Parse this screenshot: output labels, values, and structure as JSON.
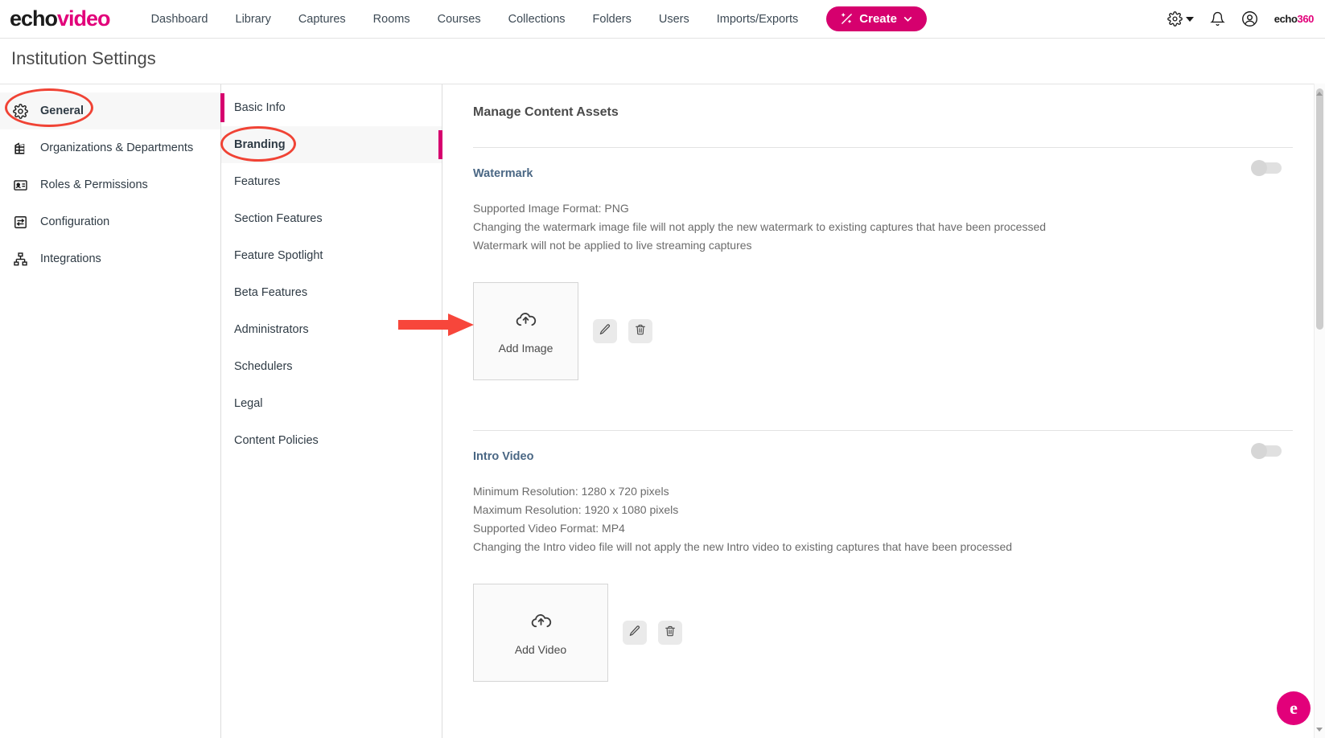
{
  "topnav": {
    "logo_first": "echo",
    "logo_second": "video",
    "links": [
      {
        "label": "Dashboard"
      },
      {
        "label": "Library"
      },
      {
        "label": "Captures"
      },
      {
        "label": "Rooms"
      },
      {
        "label": "Courses"
      },
      {
        "label": "Collections"
      },
      {
        "label": "Folders"
      },
      {
        "label": "Users"
      },
      {
        "label": "Imports/Exports"
      }
    ],
    "create_label": "Create",
    "create_icon": "magic-wand-icon",
    "create_color": "#d6006e",
    "icons": [
      "gear-icon",
      "chevron-down-icon",
      "bell-icon",
      "account-icon"
    ],
    "brand_logo_first": "echo",
    "brand_logo_second": "360"
  },
  "page": {
    "title": "Institution Settings"
  },
  "sidebar": {
    "items": [
      {
        "label": "General",
        "icon": "gear-icon",
        "active": true
      },
      {
        "label": "Organizations & Departments",
        "icon": "building-icon",
        "active": false
      },
      {
        "label": "Roles & Permissions",
        "icon": "id-card-icon",
        "active": false
      },
      {
        "label": "Configuration",
        "icon": "sliders-icon",
        "active": false
      },
      {
        "label": "Integrations",
        "icon": "sitemap-icon",
        "active": false
      }
    ]
  },
  "subnav": {
    "items": [
      {
        "label": "Basic Info",
        "railed": true,
        "current": false
      },
      {
        "label": "Branding",
        "railed": false,
        "current": true
      },
      {
        "label": "Features",
        "railed": false,
        "current": false
      },
      {
        "label": "Section Features",
        "railed": false,
        "current": false
      },
      {
        "label": "Feature Spotlight",
        "railed": false,
        "current": false
      },
      {
        "label": "Beta Features",
        "railed": false,
        "current": false
      },
      {
        "label": "Administrators",
        "railed": false,
        "current": false
      },
      {
        "label": "Schedulers",
        "railed": false,
        "current": false
      },
      {
        "label": "Legal",
        "railed": false,
        "current": false
      },
      {
        "label": "Content Policies",
        "railed": false,
        "current": false
      }
    ],
    "accent_color": "#d6006e"
  },
  "main": {
    "title": "Manage Content Assets",
    "watermark": {
      "heading": "Watermark",
      "lines": [
        "Supported Image Format: PNG",
        "Changing the watermark image file will not apply the new watermark to existing captures that have been processed",
        "Watermark will not be applied to live streaming captures"
      ],
      "dropzone_label": "Add Image",
      "dropzone_icon": "cloud-upload-icon",
      "edit_icon": "pencil-icon",
      "delete_icon": "trash-icon",
      "toggle_state": "off"
    },
    "intro_video": {
      "heading": "Intro Video",
      "lines": [
        "Minimum Resolution: 1280 x 720 pixels",
        "Maximum Resolution: 1920 x 1080 pixels",
        "Supported Video Format: MP4",
        "Changing the Intro video file will not apply the new Intro video to existing captures that have been processed"
      ],
      "dropzone_label": "Add Video",
      "dropzone_icon": "cloud-upload-icon",
      "edit_icon": "pencil-icon",
      "delete_icon": "trash-icon",
      "toggle_state": "off"
    }
  },
  "fab": {
    "label": "e",
    "color": "#e2007a"
  },
  "annotations": {
    "color": "#f04335",
    "ellipse_general": "highlight-general-sidebar-item",
    "ellipse_branding": "highlight-branding-subnav-item",
    "arrow": "arrow-pointing-to-add-image"
  }
}
